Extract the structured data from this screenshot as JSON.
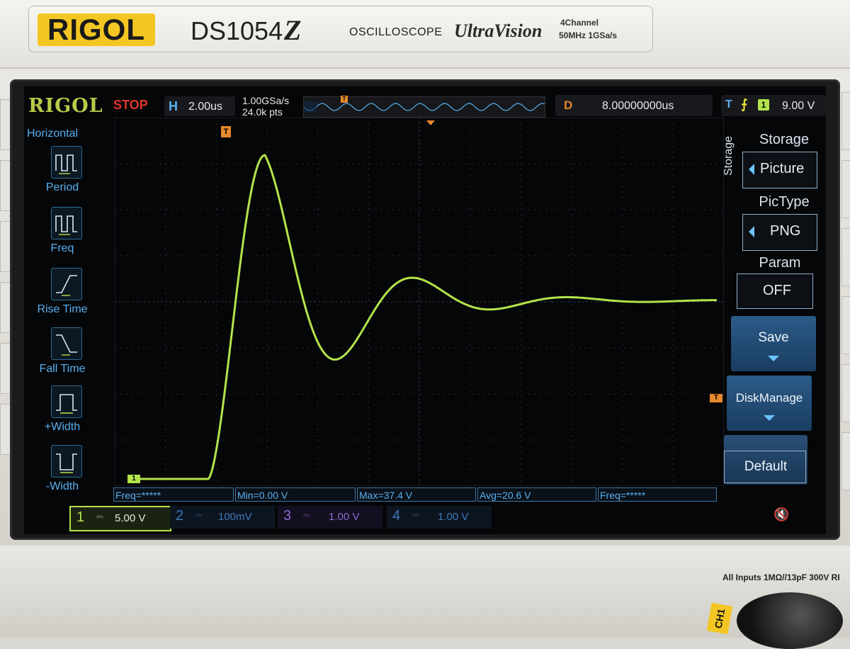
{
  "case": {
    "brand": "RIGOL",
    "model": "DS1054",
    "model_suffix": "Z",
    "product_type": "OSCILLOSCOPE",
    "series_logo": "UltraVision",
    "spec_channels": "4Channel",
    "spec_bw": "50MHz  1GSa/s",
    "inputs_label": "All Inputs 1MΩ//13pF 300V RI",
    "ch1_connector": "CH1"
  },
  "status_bar": {
    "logo": "RIGOL",
    "run_state": "STOP",
    "timebase_letter": "H",
    "timebase": "2.00us",
    "sample_rate": "1.00GSa/s",
    "memory_depth": "24.0k pts",
    "delay_letter": "D",
    "delay": "8.00000000us",
    "trigger_letter": "T",
    "trigger_edge_icon": "rising-edge-icon",
    "trigger_source": "1",
    "trigger_level": "9.00 V"
  },
  "left_menu": {
    "title": "Horizontal",
    "items": [
      {
        "label": "Period",
        "icon": "period-icon"
      },
      {
        "label": "Freq",
        "icon": "frequency-icon"
      },
      {
        "label": "Rise Time",
        "icon": "rise-time-icon"
      },
      {
        "label": "Fall Time",
        "icon": "fall-time-icon"
      },
      {
        "label": "+Width",
        "icon": "positive-width-icon"
      },
      {
        "label": "-Width",
        "icon": "negative-width-icon"
      }
    ]
  },
  "right_menu": {
    "side_label": "Storage",
    "storage_title": "Storage",
    "storage_value": "Picture",
    "pictype_title": "PicType",
    "pictype_value": "PNG",
    "param_title": "Param",
    "param_value": "OFF",
    "save_label": "Save",
    "diskmanage_label": "DiskManage",
    "default_label": "Default"
  },
  "waveform": {
    "color": "#b3e34a",
    "channel_marker": "1",
    "trigger_marker": "T",
    "description_values": {
      "baseline_v": 0.0,
      "max_v": 37.4,
      "settled_v": 20.6
    }
  },
  "measurements": [
    {
      "label": "Freq=*****"
    },
    {
      "label": "Min=0.00 V"
    },
    {
      "label": "Max=37.4 V"
    },
    {
      "label": "Avg=20.6 V"
    },
    {
      "label": "Freq=*****"
    }
  ],
  "channels": [
    {
      "num": "1",
      "coupling": "⎓",
      "scale": "5.00 V",
      "color": "#b3e34a",
      "active": true
    },
    {
      "num": "2",
      "coupling": "⎓",
      "scale": "100mV",
      "color": "#3c78b8",
      "active": false
    },
    {
      "num": "3",
      "coupling": "⎓",
      "scale": "1.00 V",
      "color": "#8b6ad0",
      "active": false
    },
    {
      "num": "4",
      "coupling": "⎓",
      "scale": "1.00 V",
      "color": "#3c78b8",
      "active": false
    }
  ],
  "colors": {
    "trace": "#b3e34a",
    "ui_blue": "#5ab0f0",
    "stop_red": "#e0372c",
    "delay_orange": "#e6892d"
  }
}
